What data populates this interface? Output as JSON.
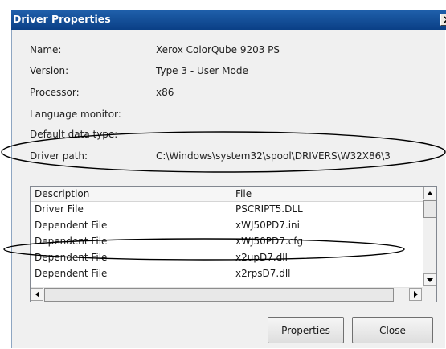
{
  "window": {
    "title": "Driver Properties"
  },
  "properties": [
    {
      "label": "Name:",
      "value": "Xerox ColorQube 9203 PS"
    },
    {
      "label": "Version:",
      "value": "Type 3 - User Mode"
    },
    {
      "label": "Processor:",
      "value": "x86"
    },
    {
      "label": "Language monitor:",
      "value": ""
    },
    {
      "label": "Default data type:",
      "value": ""
    },
    {
      "label": "Driver path:",
      "value": "C:\\Windows\\system32\\spool\\DRIVERS\\W32X86\\3"
    }
  ],
  "files_table": {
    "columns": [
      "Description",
      "File"
    ],
    "rows": [
      {
        "description": "Driver File",
        "file": "PSCRIPT5.DLL"
      },
      {
        "description": "Dependent File",
        "file": "xWJ50PD7.ini"
      },
      {
        "description": "Dependent File",
        "file": "xWJ50PD7.cfg"
      },
      {
        "description": "Dependent File",
        "file": "x2upD7.dll"
      },
      {
        "description": "Dependent File",
        "file": "x2rpsD7.dll"
      }
    ]
  },
  "buttons": {
    "properties": "Properties",
    "close": "Close"
  },
  "icons": {
    "close": "close-icon",
    "scroll_up": "arrow-up-icon",
    "scroll_down": "arrow-down-icon",
    "scroll_left": "arrow-left-icon",
    "scroll_right": "arrow-right-icon"
  },
  "colors": {
    "titlebar": "#0a3f86",
    "dialog_bg": "#f0f0f0",
    "annotation": "#000000"
  }
}
